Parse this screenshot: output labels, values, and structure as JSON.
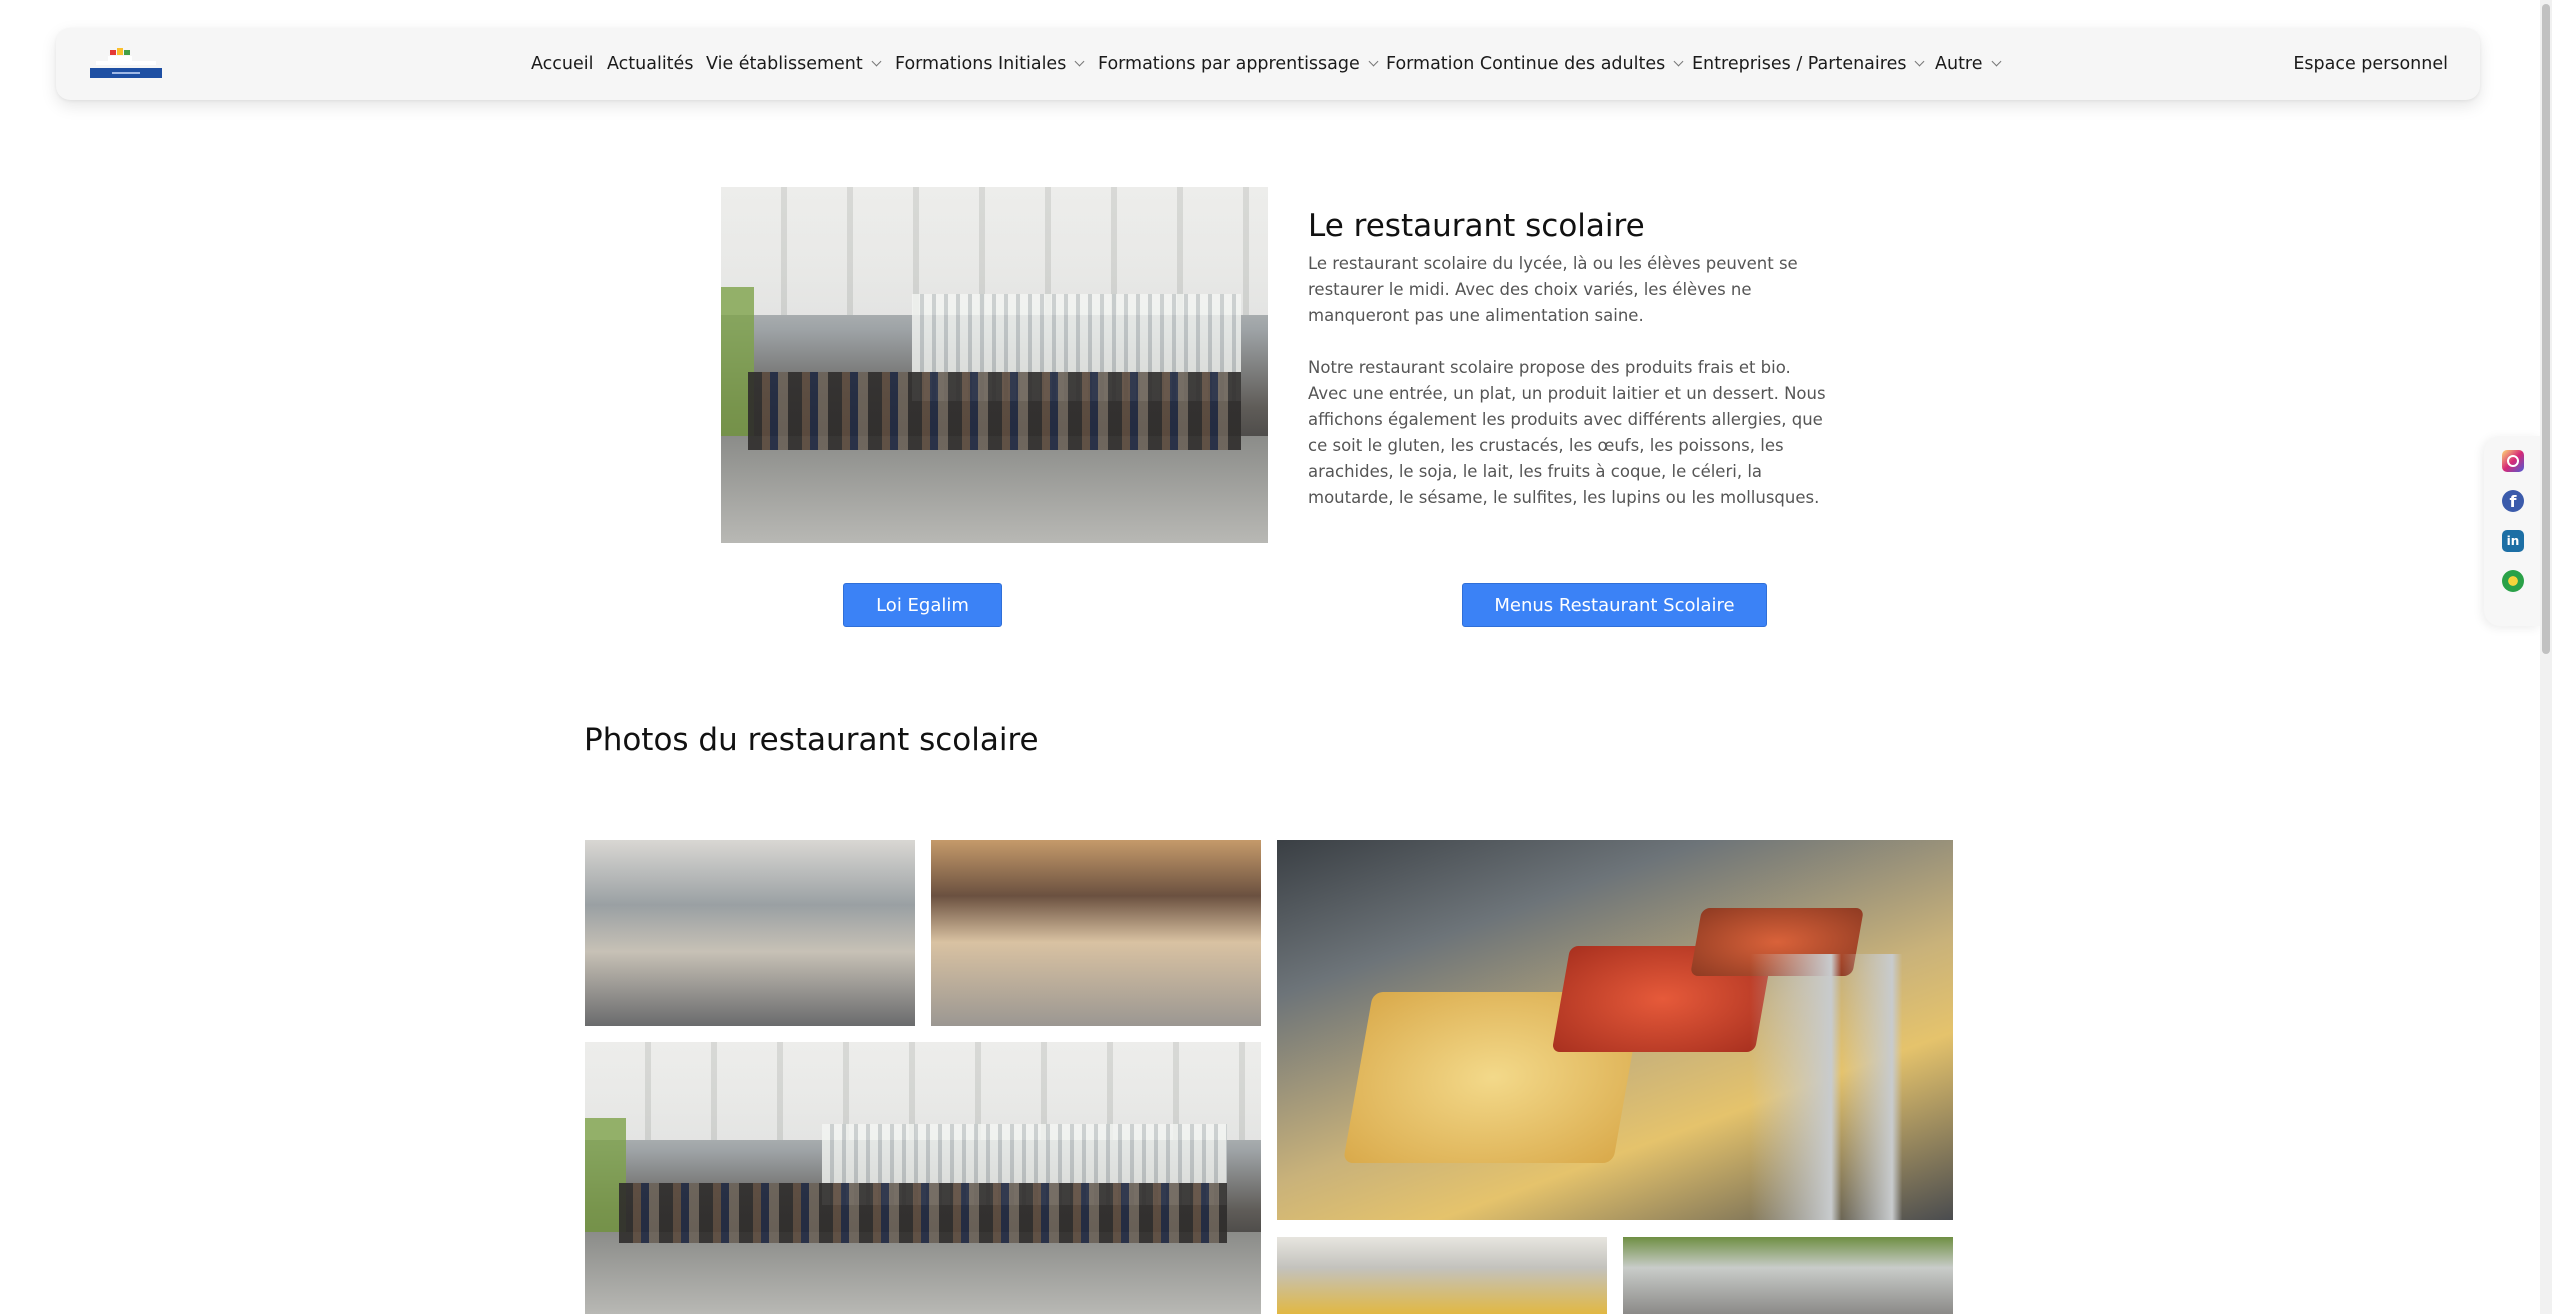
{
  "header": {
    "logo_icon": "school-logo",
    "nav": [
      {
        "label": "Accueil",
        "dropdown": false
      },
      {
        "label": "Actualités",
        "dropdown": false
      },
      {
        "label": "Vie établissement",
        "dropdown": true
      },
      {
        "label": "Formations Initiales",
        "dropdown": true
      },
      {
        "label": "Formations par apprentissage",
        "dropdown": true
      },
      {
        "label": "Formation Continue des adultes",
        "dropdown": true
      },
      {
        "label": "Entreprises / Partenaires",
        "dropdown": true
      },
      {
        "label": "Autre",
        "dropdown": true
      }
    ],
    "espace_label": "Espace personnel"
  },
  "main": {
    "title": "Le restaurant scolaire",
    "paragraph1": "Le restaurant scolaire du lycée, là ou les élèves peuvent se restaurer le midi. Avec des choix variés, les élèves ne manqueront pas une alimentation saine.",
    "paragraph2": "Notre restaurant scolaire propose des produits frais et bio. Avec une entrée, un plat, un produit laitier et un dessert. Nous affichons également les produits avec différents allergies, que ce soit le gluten, les crustacés, les œufs, les poissons, les arachides, le soja, le lait, les fruits à coque, le céleri, la moutarde, le sésame, le sulfites, les lupins ou les mollusques.",
    "buttons": {
      "loi": "Loi Egalim",
      "menus": "Menus Restaurant Scolaire"
    }
  },
  "gallery": {
    "title": "Photos du restaurant scolaire"
  },
  "social": [
    "instagram-icon",
    "facebook-icon",
    "linkedin-icon",
    "other-social-icon"
  ],
  "colors": {
    "accent": "#3b82f6",
    "header_bg": "#f6f6f6",
    "text_muted": "#555555"
  }
}
